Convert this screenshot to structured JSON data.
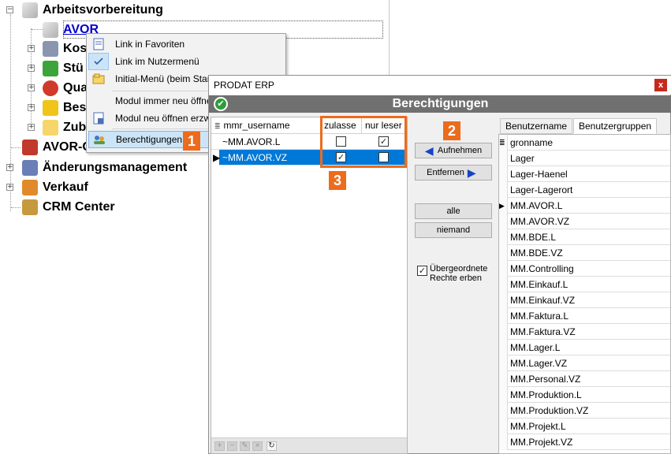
{
  "tree": {
    "items": [
      {
        "label": "Arbeitsvorbereitung",
        "icon": "pencil-icon"
      },
      {
        "label": "AVOR",
        "icon": "pencil-icon"
      },
      {
        "label": "Kos",
        "icon": "printer-icon"
      },
      {
        "label": "Stü",
        "icon": "green-parts-icon"
      },
      {
        "label": "Qua",
        "icon": "quality-icon"
      },
      {
        "label": "Bes",
        "icon": "basket-icon"
      },
      {
        "label": "Zub",
        "icon": "folder-icon"
      },
      {
        "label": "AVOR-Center",
        "icon": "bus-icon"
      },
      {
        "label": "Änderungsmanagement",
        "icon": "change-icon"
      },
      {
        "label": "Verkauf",
        "icon": "handshake-icon"
      },
      {
        "label": "CRM Center",
        "icon": "crm-icon"
      }
    ]
  },
  "context_menu": {
    "items": [
      {
        "label": "Link in Favoriten",
        "icon": "document-icon"
      },
      {
        "label": "Link im Nutzermenü",
        "icon": "check-icon"
      },
      {
        "label": "Initial-Menü (beim Star",
        "icon": "menu-star-icon"
      },
      {
        "label": "Modul immer neu öffne",
        "icon": ""
      },
      {
        "label": "Modul neu öffnen erzw",
        "icon": "document-icon"
      },
      {
        "label": "Berechtigungen",
        "icon": "users-icon"
      }
    ]
  },
  "dialog": {
    "window_title": "PRODAT ERP",
    "close_label": "x",
    "header": "Berechtigungen",
    "grid": {
      "columns": [
        "mmr_username",
        "zulasse",
        "nur leser"
      ],
      "rows": [
        {
          "user": "~MM.AVOR.L",
          "zulassen": false,
          "nur_lesen": true,
          "selected": false
        },
        {
          "user": "~MM.AVOR.VZ",
          "zulassen": true,
          "nur_lesen": false,
          "selected": true
        }
      ]
    },
    "buttons": {
      "aufnehmen": "Aufnehmen",
      "entfernen": "Entfernen",
      "alle": "alle",
      "niemand": "niemand"
    },
    "inherit_checkbox": {
      "label": "Übergeordnete Rechte erben",
      "checked": true
    },
    "tabs": [
      "Benutzername",
      "Benutzergruppen"
    ],
    "active_tab": "Benutzergruppen",
    "group_list_header": "gronname",
    "groups": [
      "Lager",
      "Lager-Haenel",
      "Lager-Lagerort",
      "MM.AVOR.L",
      "MM.AVOR.VZ",
      "MM.BDE.L",
      "MM.BDE.VZ",
      "MM.Controlling",
      "MM.Einkauf.L",
      "MM.Einkauf.VZ",
      "MM.Faktura.L",
      "MM.Faktura.VZ",
      "MM.Lager.L",
      "MM.Lager.VZ",
      "MM.Personal.VZ",
      "MM.Produktion.L",
      "MM.Produktion.VZ",
      "MM.Projekt.L",
      "MM.Projekt.VZ"
    ],
    "current_group": "MM.AVOR.L"
  },
  "annotations": {
    "badge1": "1",
    "badge2": "2",
    "badge3": "3"
  },
  "colors": {
    "accent_orange": "#ec6b1c",
    "selection_blue": "#0078d7",
    "header_gray": "#707070"
  }
}
